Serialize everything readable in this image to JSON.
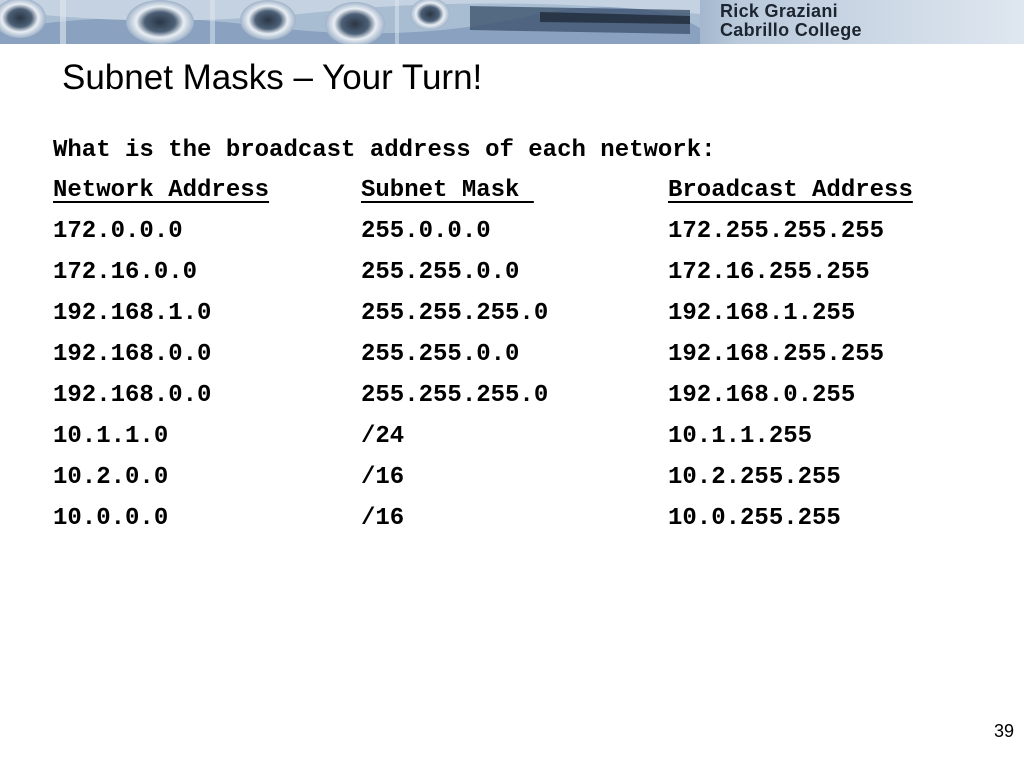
{
  "header": {
    "author_line": "Rick Graziani",
    "institution_line": "Cabrillo College"
  },
  "title": "Subnet Masks – Your Turn!",
  "question": "What is the broadcast address of each network:",
  "table": {
    "headers": [
      "Network Address",
      "Subnet Mask ",
      "Broadcast Address"
    ],
    "rows": [
      [
        "172.0.0.0",
        "255.0.0.0",
        "172.255.255.255"
      ],
      [
        "172.16.0.0",
        "255.255.0.0",
        "172.16.255.255"
      ],
      [
        "192.168.1.0",
        "255.255.255.0",
        "192.168.1.255"
      ],
      [
        "192.168.0.0",
        "255.255.0.0",
        "192.168.255.255"
      ],
      [
        "192.168.0.0",
        "255.255.255.0",
        "192.168.0.255"
      ],
      [
        "10.1.1.0",
        "/24",
        "10.1.1.255"
      ],
      [
        "10.2.0.0",
        "/16",
        "10.2.255.255"
      ],
      [
        "10.0.0.0",
        "/16",
        "10.0.255.255"
      ]
    ]
  },
  "page_number": "39",
  "colors": {
    "banner_dark": "#5f7ea6",
    "banner_light": "#dfe7f0",
    "text": "#000000"
  }
}
